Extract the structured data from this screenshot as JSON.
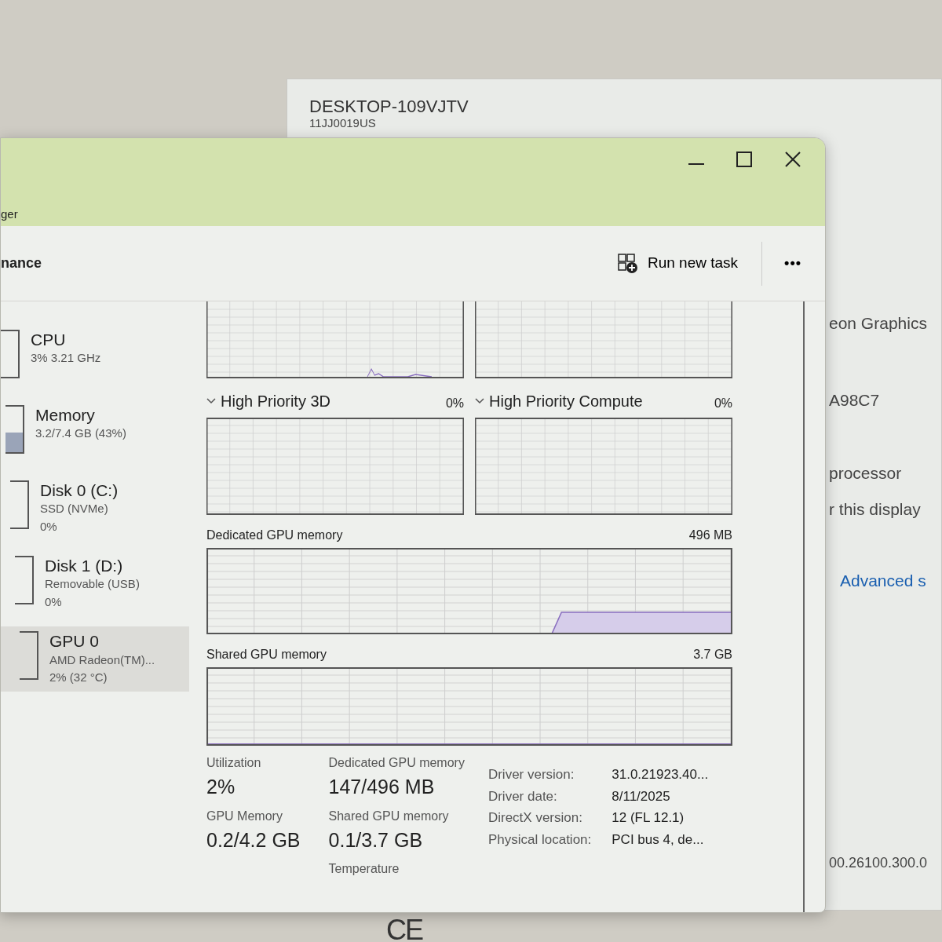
{
  "background_window": {
    "device_name": "DESKTOP-109VJTV",
    "model": "11JJ0019US",
    "details": [
      "eon Graphics",
      "A98C7",
      "processor",
      "r this display"
    ],
    "link": "Advanced s",
    "version": "00.26100.300.0"
  },
  "window": {
    "title": "ger",
    "page_title": "nance",
    "toolbar": {
      "run_task": "Run new task",
      "more": "•••"
    }
  },
  "sidebar": {
    "items": [
      {
        "name": "CPU",
        "lines": [
          "3% 3.21 GHz"
        ],
        "selected": false
      },
      {
        "name": "Memory",
        "lines": [
          "3.2/7.4 GB (43%)"
        ],
        "level": 0.43,
        "selected": false
      },
      {
        "name": "Disk 0 (C:)",
        "lines": [
          "SSD (NVMe)",
          "0%"
        ],
        "selected": false
      },
      {
        "name": "Disk 1 (D:)",
        "lines": [
          "Removable (USB)",
          "0%"
        ],
        "selected": false
      },
      {
        "name": "GPU 0",
        "lines": [
          "AMD Radeon(TM)...",
          "2% (32 °C)"
        ],
        "selected": true
      }
    ]
  },
  "engines": [
    {
      "label": "High Priority 3D",
      "reading": "0%"
    },
    {
      "label": "High Priority Compute",
      "reading": "0%"
    }
  ],
  "memory_graphs": [
    {
      "label": "Dedicated GPU memory",
      "max": "496 MB",
      "kind": "step"
    },
    {
      "label": "Shared GPU memory",
      "max": "3.7 GB",
      "kind": "flat"
    }
  ],
  "stats": [
    [
      {
        "label": "Utilization",
        "value": "2%"
      },
      {
        "label": "GPU Memory",
        "value": "0.2/4.2 GB"
      }
    ],
    [
      {
        "label": "Dedicated GPU memory",
        "value": "147/496 MB"
      },
      {
        "label": "Shared GPU memory",
        "value": "0.1/3.7 GB"
      },
      {
        "label": "Temperature"
      }
    ]
  ],
  "details": [
    {
      "label": "Driver version:",
      "value": "31.0.21923.40..."
    },
    {
      "label": "Driver date:",
      "value": "8/11/2025"
    },
    {
      "label": "DirectX version:",
      "value": "12 (FL 12.1)"
    },
    {
      "label": "Physical location:",
      "value": "PCI bus 4, de..."
    }
  ],
  "bezel": {
    "mark": "CE"
  }
}
